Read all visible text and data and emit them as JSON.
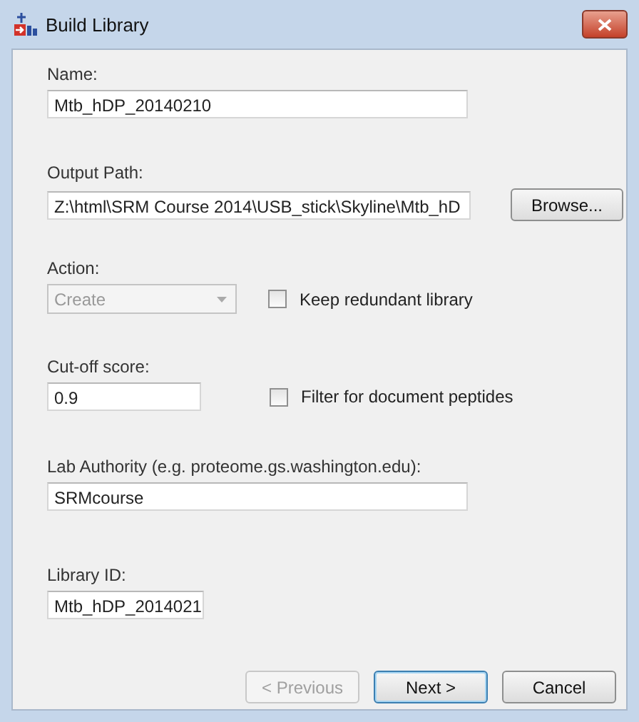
{
  "window": {
    "title": "Build Library"
  },
  "name": {
    "label": "Name:",
    "value": "Mtb_hDP_20140210"
  },
  "output_path": {
    "label": "Output Path:",
    "value": "Z:\\html\\SRM Course 2014\\USB_stick\\Skyline\\Mtb_hD",
    "browse": "Browse..."
  },
  "action": {
    "label": "Action:",
    "value": "Create",
    "disabled": true
  },
  "keep_redundant": {
    "label": "Keep redundant library",
    "checked": false
  },
  "cutoff": {
    "label": "Cut-off score:",
    "value": "0.9"
  },
  "filter": {
    "label": "Filter for document peptides",
    "checked": false
  },
  "lab_authority": {
    "label": "Lab Authority (e.g. proteome.gs.washington.edu):",
    "value": "SRMcourse"
  },
  "library_id": {
    "label": "Library ID:",
    "value": "Mtb_hDP_2014021"
  },
  "buttons": [
    {
      "label": "< Previous",
      "disabled": true,
      "default": false
    },
    {
      "label": "Next >",
      "disabled": false,
      "default": true
    },
    {
      "label": "Cancel",
      "disabled": false,
      "default": false
    }
  ]
}
